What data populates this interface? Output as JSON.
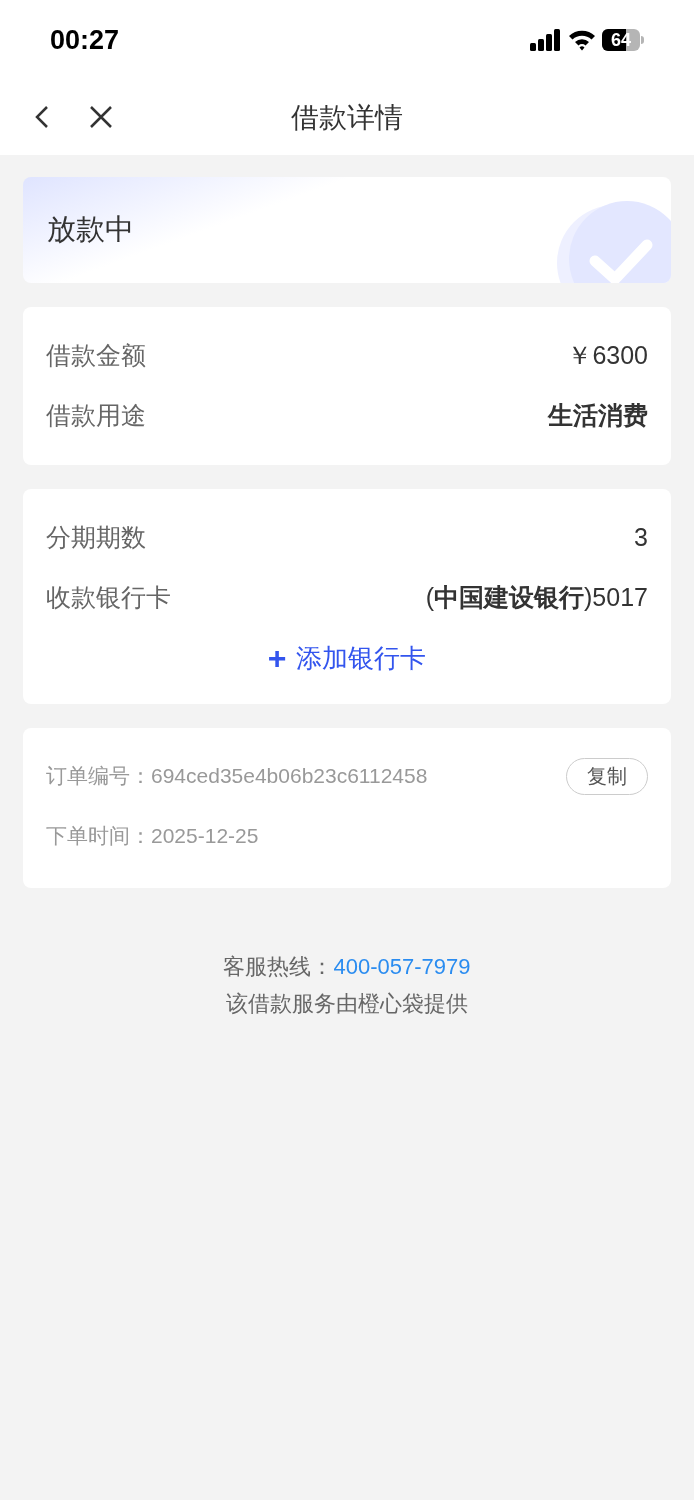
{
  "status_bar": {
    "time": "00:27",
    "battery": "64"
  },
  "nav": {
    "title": "借款详情"
  },
  "status_card": {
    "label": "放款中"
  },
  "loan_card": {
    "rows": [
      {
        "label": "借款金额",
        "value": "￥6300",
        "bold": false
      },
      {
        "label": "借款用途",
        "value": "生活消费",
        "bold": true
      }
    ]
  },
  "bank_card": {
    "rows": [
      {
        "label": "分期期数",
        "value": "3",
        "bold": false
      },
      {
        "label": "收款银行卡",
        "value": "(**中国建设银行**)5017",
        "bold": false
      }
    ],
    "add_button": {
      "icon": "+",
      "label": "添加银行卡"
    }
  },
  "order_card": {
    "order_label": "订单编号：",
    "order_number": "694ced35e4b06b23c6112458",
    "copy_button": "复制",
    "time_label": "下单时间：",
    "time_value": "2025-12-25"
  },
  "footer": {
    "hotline_label": "客服热线：",
    "hotline": "400-057-7979",
    "provider": "该借款服务由橙心袋提供"
  }
}
